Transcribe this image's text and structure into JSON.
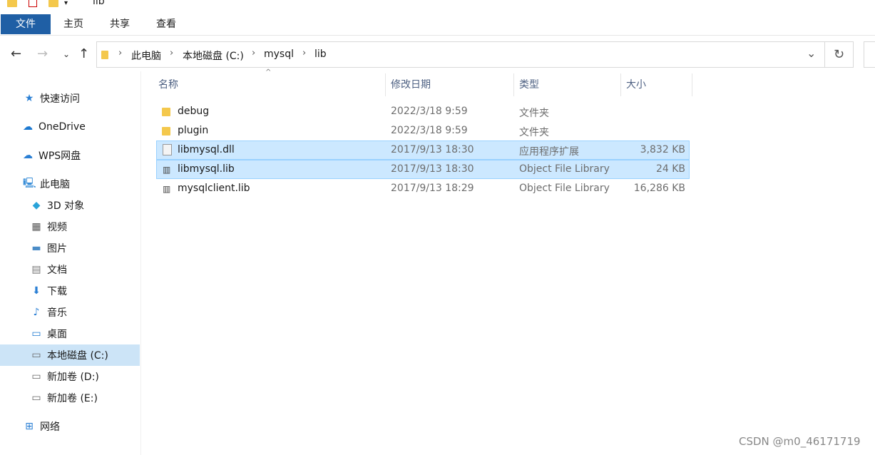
{
  "window": {
    "title": "lib"
  },
  "ribbon": {
    "tabs": [
      "文件",
      "主页",
      "共享",
      "查看"
    ]
  },
  "address": {
    "crumbs": [
      "此电脑",
      "本地磁盘 (C:)",
      "mysql",
      "lib"
    ]
  },
  "sidebar": {
    "items": [
      {
        "label": "快速访问",
        "icon": "star-icon"
      },
      {
        "label": "OneDrive",
        "icon": "cloud-icon"
      },
      {
        "label": "WPS网盘",
        "icon": "cloud-icon"
      },
      {
        "label": "此电脑",
        "icon": "computer-icon"
      },
      {
        "label": "3D 对象",
        "icon": "cube-icon"
      },
      {
        "label": "视频",
        "icon": "video-icon"
      },
      {
        "label": "图片",
        "icon": "picture-icon"
      },
      {
        "label": "文档",
        "icon": "document-icon"
      },
      {
        "label": "下载",
        "icon": "download-icon"
      },
      {
        "label": "音乐",
        "icon": "music-icon"
      },
      {
        "label": "桌面",
        "icon": "desktop-icon"
      },
      {
        "label": "本地磁盘 (C:)",
        "icon": "drive-icon"
      },
      {
        "label": "新加卷 (D:)",
        "icon": "drive-icon"
      },
      {
        "label": "新加卷 (E:)",
        "icon": "drive-icon"
      },
      {
        "label": "网络",
        "icon": "network-icon"
      }
    ]
  },
  "columns": [
    "名称",
    "修改日期",
    "类型",
    "大小"
  ],
  "files": [
    {
      "name": "debug",
      "modified": "2022/3/18 9:59",
      "type": "文件夹",
      "size": "",
      "icon": "folder-icon"
    },
    {
      "name": "plugin",
      "modified": "2022/3/18 9:59",
      "type": "文件夹",
      "size": "",
      "icon": "folder-icon"
    },
    {
      "name": "libmysql.dll",
      "modified": "2017/9/13 18:30",
      "type": "应用程序扩展",
      "size": "3,832 KB",
      "icon": "dll-file-icon"
    },
    {
      "name": "libmysql.lib",
      "modified": "2017/9/13 18:30",
      "type": "Object File Library",
      "size": "24 KB",
      "icon": "lib-file-icon"
    },
    {
      "name": "mysqlclient.lib",
      "modified": "2017/9/13 18:29",
      "type": "Object File Library",
      "size": "16,286 KB",
      "icon": "lib-file-icon"
    }
  ],
  "watermark": "CSDN @m0_46171719",
  "colors": {
    "ribbon_file_tab": "#1f5fa5",
    "selection": "#cce8ff",
    "selection_border": "#99d1ff"
  }
}
